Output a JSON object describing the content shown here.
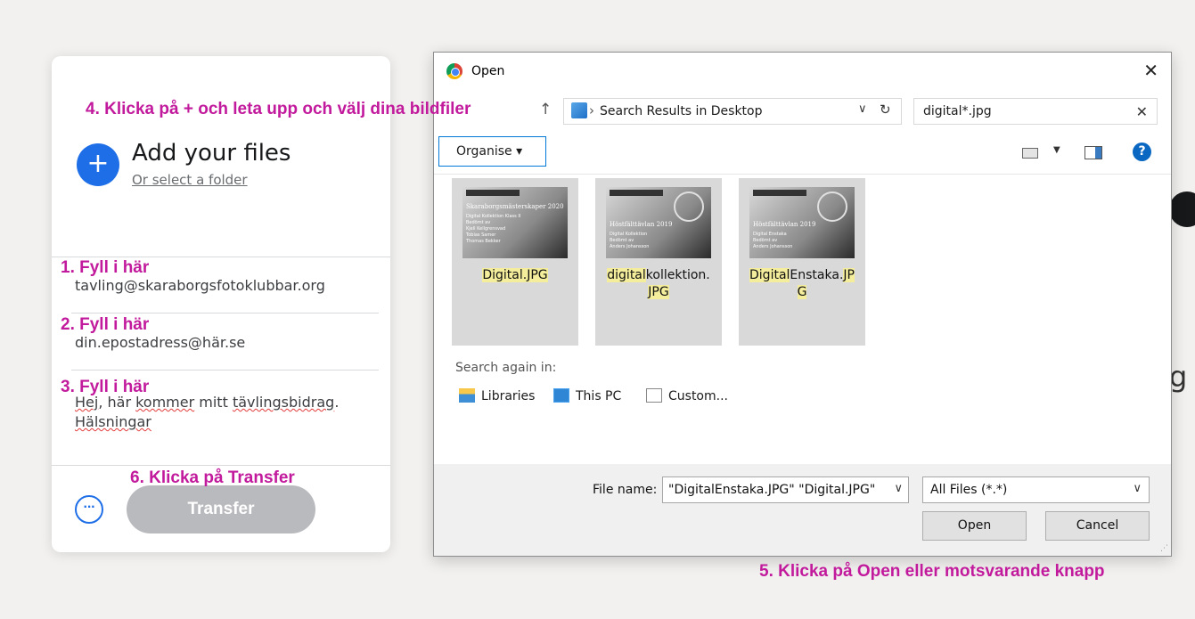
{
  "panel": {
    "add_title": "Add your files",
    "select_folder": "Or select a folder",
    "email_to": "tavling@skaraborgsfotoklubbar.org",
    "email_from": "din.epostadress@här.se",
    "message_parts": [
      "Hej",
      ", här ",
      "kommer",
      " mitt ",
      "tävlingsbidrag",
      "."
    ],
    "message_line2": "Hälsningar",
    "more_label": "···",
    "transfer_label": "Transfer"
  },
  "annotations": {
    "step1": "1. Fyll i här",
    "step2": "2. Fyll i här",
    "step3": "3. Fyll i här",
    "step4": "4. Klicka på + och leta upp och välj dina bildfiler",
    "step5": "5. Klicka på Open eller motsvarande knapp",
    "step6": "6. Klicka på Transfer"
  },
  "dialog": {
    "title": "Open",
    "close": "✕",
    "address": "Search Results in Desktop",
    "address_sep": "›",
    "search_query": "digital*.jpg",
    "organise": "Organise ▾",
    "help": "?",
    "files": [
      {
        "thumb_title": "Skaraborgsmästerskaper 2020",
        "thumb_lines": [
          "Digital Kollektion Klass II",
          "Bedömt av",
          "Kjell Kellgrensvad",
          "Tobias Samer",
          "Thomas Bekker"
        ],
        "name_parts": [
          [
            "Digital",
            true
          ],
          [
            ".JPG",
            true
          ]
        ]
      },
      {
        "thumb_title": "Höstfälttävlan 2019",
        "thumb_lines": [
          "Digital Kollektion",
          "Bedömt av",
          "Anders Johansson"
        ],
        "name_parts": [
          [
            "digital",
            true
          ],
          [
            "kollektion.",
            false
          ],
          [
            "JPG",
            true
          ]
        ]
      },
      {
        "thumb_title": "Höstfälttävlan 2019",
        "thumb_lines": [
          "Digital Enstaka",
          "Bedömt av",
          "Anders Johansson"
        ],
        "name_parts": [
          [
            "Digital",
            true
          ],
          [
            "Enstaka.",
            false
          ],
          [
            "JP",
            true
          ],
          [
            "G",
            true
          ]
        ]
      }
    ],
    "search_again": "Search again in:",
    "locations": [
      "Libraries",
      "This PC",
      "Custom..."
    ],
    "file_name_label": "File name:",
    "file_name_value": "\"DigitalEnstaka.JPG\" \"Digital.JPG\"",
    "file_type": "All Files (*.*)",
    "open_label": "Open",
    "cancel_label": "Cancel"
  },
  "background": {
    "partial_letter": "g"
  }
}
